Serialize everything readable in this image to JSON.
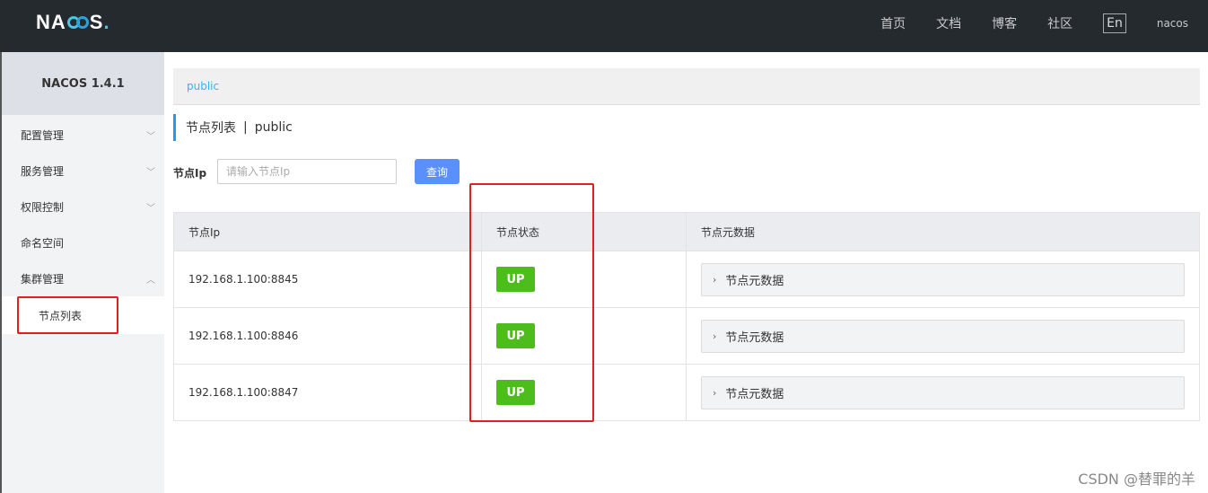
{
  "header": {
    "logo": "NACOS",
    "nav": [
      "首页",
      "文档",
      "博客",
      "社区"
    ],
    "lang": "En",
    "user": "nacos"
  },
  "sidebar": {
    "title": "NACOS 1.4.1",
    "items": [
      {
        "label": "配置管理"
      },
      {
        "label": "服务管理"
      },
      {
        "label": "权限控制"
      },
      {
        "label": "命名空间"
      },
      {
        "label": "集群管理"
      }
    ],
    "sub_item": "节点列表"
  },
  "breadcrumb": "public",
  "page": {
    "title": "节点列表",
    "sep": "|",
    "namespace": "public"
  },
  "query": {
    "label": "节点Ip",
    "placeholder": "请输入节点Ip",
    "button": "查询"
  },
  "table": {
    "headers": [
      "节点Ip",
      "节点状态",
      "节点元数据"
    ],
    "rows": [
      {
        "ip": "192.168.1.100:8845",
        "state": "UP",
        "meta": "节点元数据"
      },
      {
        "ip": "192.168.1.100:8846",
        "state": "UP",
        "meta": "节点元数据"
      },
      {
        "ip": "192.168.1.100:8847",
        "state": "UP",
        "meta": "节点元数据"
      }
    ]
  },
  "watermark": "CSDN @替罪的羊",
  "colors": {
    "header_bg": "#252a2f",
    "badge_up": "#4cbd1b",
    "primary": "#5b8ff9",
    "highlight": "#e02020"
  }
}
